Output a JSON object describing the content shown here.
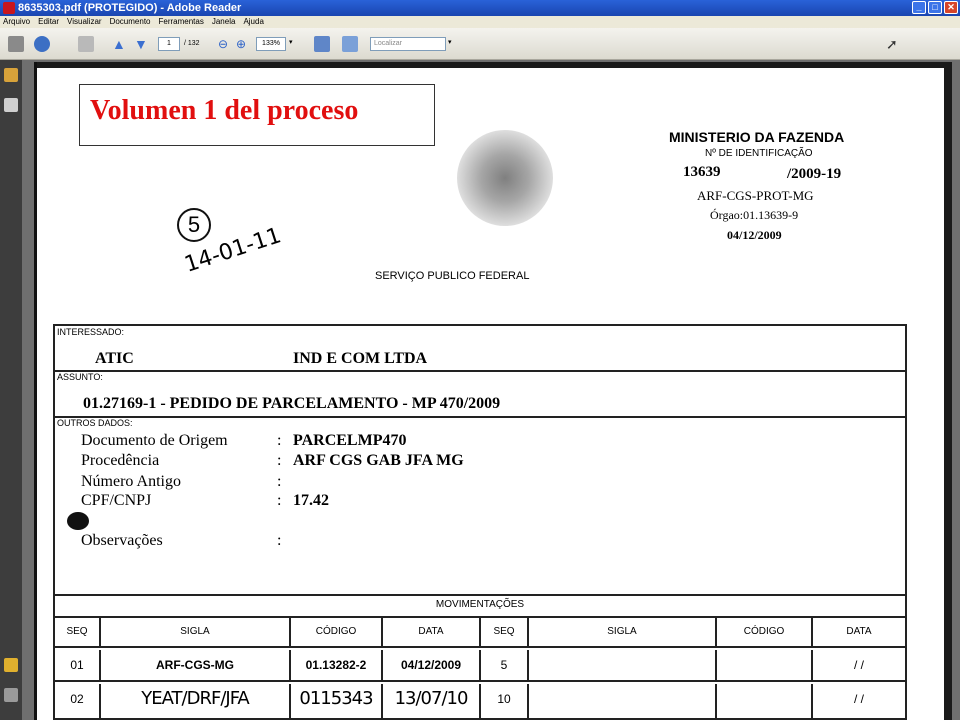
{
  "window": {
    "title": "8635303.pdf (PROTEGIDO) - Adobe Reader",
    "btn_min": "_",
    "btn_max": "□",
    "btn_close": "✕"
  },
  "menu": [
    "Arquivo",
    "Editar",
    "Visualizar",
    "Documento",
    "Ferramentas",
    "Janela",
    "Ajuda"
  ],
  "toolbar": {
    "page_current": "1",
    "page_total": "/ 132",
    "zoom": "133%",
    "find_placeholder": "Localizar",
    "caret": "▾"
  },
  "document": {
    "stamp": "Volumen 1 del proceso",
    "ministry": "MINISTERIO DA FAZENDA",
    "id_label": "Nº DE IDENTIFICAÇÃO",
    "id_left": "13639",
    "id_right": "/2009-19",
    "prot": "ARF-CGS-PROT-MG",
    "orgao": "Órgao:01.13639-9",
    "date": "04/12/2009",
    "hand_number": "5",
    "hand_date": "14-01-11",
    "servico": "SERVIÇO PUBLICO FEDERAL",
    "labels": {
      "interessado": "INTERESSADO:",
      "assunto": "ASSUNTO:",
      "outros": "OUTROS DADOS:"
    },
    "interessado_a": "ATIC",
    "interessado_b": "IND E COM LTDA",
    "assunto": "01.27169-1 - PEDIDO DE PARCELAMENTO - MP 470/2009",
    "outros": [
      {
        "key": "Documento de Origem",
        "value": "PARCELMP470"
      },
      {
        "key": "Procedência",
        "value": "ARF CGS GAB JFA MG"
      },
      {
        "key": "Número Antigo",
        "value": ""
      },
      {
        "key": "CPF/CNPJ",
        "value": "17.42"
      },
      {
        "key": "Observações",
        "value": ""
      }
    ],
    "colon": ":",
    "mov_title": "MOVIMENTAÇÕES",
    "mov_headers": [
      "SEQ",
      "SIGLA",
      "CÓDIGO",
      "DATA",
      "SEQ",
      "SIGLA",
      "CÓDIGO",
      "DATA"
    ],
    "mov_rows": [
      [
        "01",
        "ARF-CGS-MG",
        "01.13282-2",
        "04/12/2009",
        "5",
        "",
        "",
        "/ /"
      ],
      [
        "02",
        "YEAT/DRF/JFA",
        "0115343",
        "13/07/10",
        "10",
        "",
        "",
        "/ /"
      ]
    ]
  }
}
